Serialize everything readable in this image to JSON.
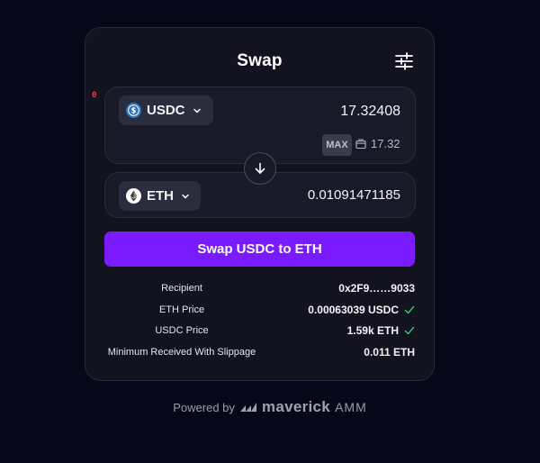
{
  "header": {
    "title": "Swap",
    "settings_icon": "sliders-icon"
  },
  "badge": {
    "text": "0",
    "color": "#ff3b30"
  },
  "from": {
    "token": "USDC",
    "token_icon": "usdc-icon",
    "amount": "17.32408",
    "max_label": "MAX",
    "balance": "17.32"
  },
  "to": {
    "token": "ETH",
    "token_icon": "eth-icon",
    "amount": "0.01091471185"
  },
  "swap_button": {
    "label": "Swap USDC to ETH",
    "color": "#7a1bff"
  },
  "details": [
    {
      "label": "Recipient",
      "value": "0x2F9……9033",
      "check": false
    },
    {
      "label": "ETH Price",
      "value": "0.00063039 USDC",
      "check": true
    },
    {
      "label": "USDC Price",
      "value": "1.59k ETH",
      "check": true
    },
    {
      "label": "Minimum Received With Slippage",
      "value": "0.011 ETH",
      "check": false
    }
  ],
  "footer": {
    "powered_by": "Powered by",
    "brand": "maverick",
    "suffix": "AMM"
  },
  "colors": {
    "background": "#07071a",
    "card": "#12131f",
    "panel": "#191a28",
    "check": "#2ecc71"
  }
}
